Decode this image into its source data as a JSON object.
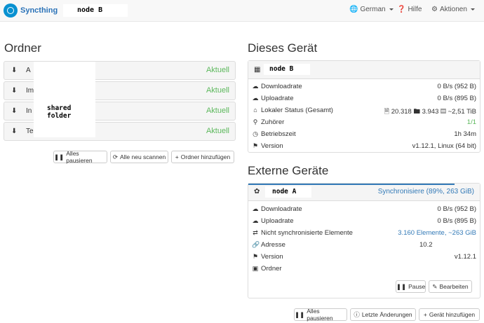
{
  "navbar": {
    "brand": "Syncthing",
    "device_name": "node B",
    "language": "German",
    "help": "Hilfe",
    "actions": "Aktionen"
  },
  "folders": {
    "title": "Ordner",
    "items": [
      {
        "name": "A",
        "status": "Aktuell"
      },
      {
        "name": "Im",
        "status": "Aktuell"
      },
      {
        "name": "In",
        "status": "Aktuell"
      },
      {
        "name": "Te",
        "status": "Aktuell"
      }
    ],
    "redaction_label": "shared folder",
    "buttons": {
      "pause_all": "Alles pausieren",
      "rescan_all": "Alle neu scannen",
      "add_folder": "Ordner hinzufügen"
    }
  },
  "this_device": {
    "title": "Dieses Gerät",
    "name": "node B",
    "rows": {
      "download_label": "Downloadrate",
      "download_value": "0 B/s (952 B)",
      "upload_label": "Uploadrate",
      "upload_value": "0 B/s (895 B)",
      "local_state_label": "Lokaler Status (Gesamt)",
      "files": "20.318",
      "dirs": "3.943",
      "size": "~2,51 TiB",
      "listeners_label": "Zuhörer",
      "listeners_value": "1/1",
      "uptime_label": "Betriebszeit",
      "uptime_value": "1h 34m",
      "version_label": "Version",
      "version_value": "v1.12.1, Linux (64 bit)"
    }
  },
  "remote_devices": {
    "title": "Externe Geräte",
    "device": {
      "name": "node A",
      "status": "Synchronisiere (89%, 263 GiB)",
      "progress": 0.89,
      "download_label": "Downloadrate",
      "download_value": "0 B/s (952 B)",
      "upload_label": "Uploadrate",
      "upload_value": "0 B/s (895 B)",
      "out_of_sync_label": "Nicht synchronisierte Elemente",
      "out_of_sync_value": "3.160 Elemente, ~263 GiB",
      "address_label": "Adresse",
      "address_value": "10.2",
      "version_label": "Version",
      "version_value": "v1.12.1",
      "folders_label": "Ordner",
      "pause": "Pause",
      "edit": "Bearbeiten"
    },
    "buttons": {
      "pause_all": "Alles pausieren",
      "recent_changes": "Letzte Änderungen",
      "add_device": "Gerät hinzufügen"
    }
  },
  "colors": {
    "accent": "#337ab7",
    "ok": "#5cb85c",
    "brand": "#0891d1"
  }
}
